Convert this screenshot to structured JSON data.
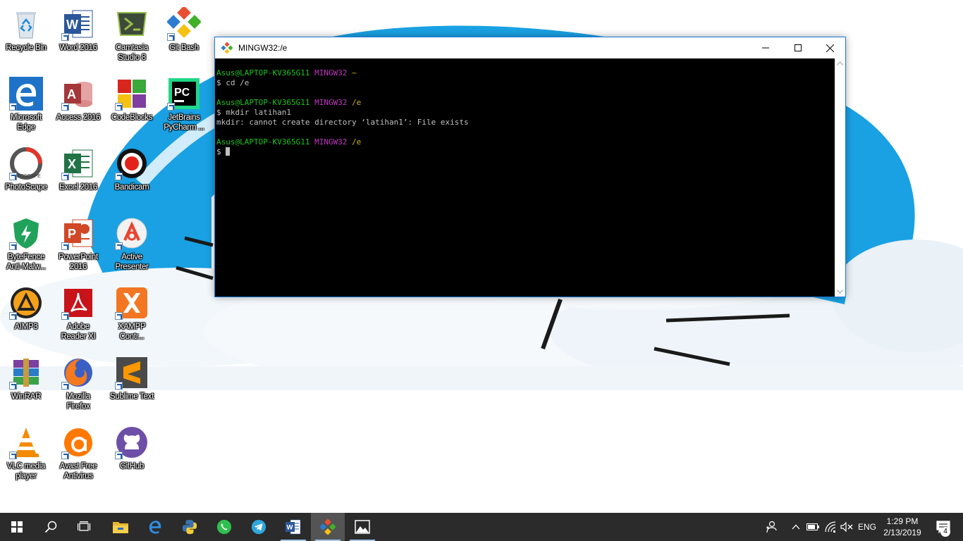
{
  "desktop": {
    "icons": [
      {
        "label": "Recycle Bin",
        "icon": "recycle-bin-icon"
      },
      {
        "label": "Word 2016",
        "icon": "word-icon"
      },
      {
        "label": "Camtasia\nStudio 8",
        "icon": "camtasia-icon"
      },
      {
        "label": "Git Bash",
        "icon": "git-bash-icon"
      },
      {
        "label": "Microsoft\nEdge",
        "icon": "edge-icon"
      },
      {
        "label": "Access 2016",
        "icon": "access-icon"
      },
      {
        "label": "CodeBlocks",
        "icon": "codeblocks-icon"
      },
      {
        "label": "JetBrains\nPyCharm ...",
        "icon": "pycharm-icon"
      },
      {
        "label": "PhotoScape",
        "icon": "photoscape-icon"
      },
      {
        "label": "Excel 2016",
        "icon": "excel-icon"
      },
      {
        "label": "Bandicam",
        "icon": "bandicam-icon"
      },
      {
        "label": "ByteFence\nAnti-Malw...",
        "icon": "bytefence-icon"
      },
      {
        "label": "PowerPoint\n2016",
        "icon": "powerpoint-icon"
      },
      {
        "label": "Active\nPresenter",
        "icon": "activepresenter-icon"
      },
      {
        "label": "AIMP3",
        "icon": "aimp-icon"
      },
      {
        "label": "Adobe\nReader XI",
        "icon": "adobe-reader-icon"
      },
      {
        "label": "XAMPP\nContr...",
        "icon": "xampp-icon"
      },
      {
        "label": "WinRAR",
        "icon": "winrar-icon"
      },
      {
        "label": "Mozilla\nFirefox",
        "icon": "firefox-icon"
      },
      {
        "label": "Sublime Text",
        "icon": "sublime-text-icon"
      },
      {
        "label": "VLC media\nplayer",
        "icon": "vlc-icon"
      },
      {
        "label": "Avast Free\nAntivirus",
        "icon": "avast-icon"
      },
      {
        "label": "GitHub",
        "icon": "github-icon"
      }
    ]
  },
  "window": {
    "title": "MINGW32:/e",
    "icon": "git-icon",
    "controls": [
      "minimize-icon",
      "maximize-icon",
      "close-icon"
    ]
  },
  "terminal": {
    "lines": [
      {
        "user": "Asus@LAPTOP-KV365G11",
        "shell": "MINGW32",
        "path": "~"
      },
      {
        "text": "$ cd /e"
      },
      {
        "text": ""
      },
      {
        "user": "Asus@LAPTOP-KV365G11",
        "shell": "MINGW32",
        "path": "/e"
      },
      {
        "text": "$ mkdir latihan1"
      },
      {
        "text": "mkdir: cannot create directory ‘latihan1’: File exists"
      },
      {
        "text": ""
      },
      {
        "user": "Asus@LAPTOP-KV365G11",
        "shell": "MINGW32",
        "path": "/e"
      },
      {
        "text": "$ ",
        "cursor": true
      }
    ],
    "colors": {
      "user": "#1ec41e",
      "shell": "#c037c0",
      "path": "#c8b41e",
      "text": "#c0c0c0",
      "background": "#000000"
    }
  },
  "taskbar": {
    "buttons": [
      {
        "icon": "windows-start-icon"
      },
      {
        "icon": "search-icon"
      },
      {
        "icon": "task-view-icon"
      },
      {
        "icon": "file-explorer-icon"
      },
      {
        "icon": "edge-icon"
      },
      {
        "icon": "python-icon"
      },
      {
        "icon": "whatsapp-icon"
      },
      {
        "icon": "telegram-icon"
      },
      {
        "icon": "word-icon"
      },
      {
        "icon": "git-bash-icon"
      },
      {
        "icon": "photos-icon"
      }
    ],
    "tray": {
      "icons": [
        "people-icon",
        "show-hidden-icon",
        "battery-icon",
        "wifi-icon",
        "volume-muted-icon"
      ],
      "language": "ENG",
      "time": "1:29 PM",
      "date": "2/13/2019",
      "notifications": "4"
    },
    "colors": {
      "background": "#2b2b2b",
      "active": "#545454",
      "running_indicator": "#9fc7ef"
    }
  }
}
